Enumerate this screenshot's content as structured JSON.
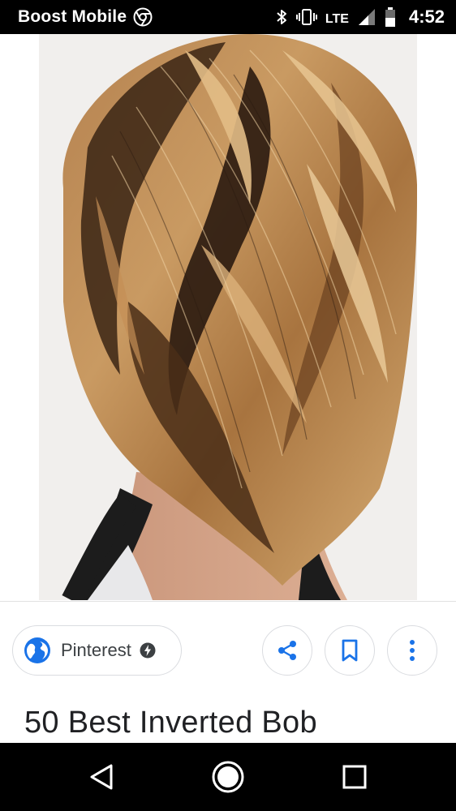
{
  "status_bar": {
    "carrier": "Boost Mobile",
    "network": "LTE",
    "time": "4:52",
    "icons": [
      "chrome-icon",
      "bluetooth-icon",
      "vibrate-icon",
      "signal-icon",
      "battery-icon"
    ]
  },
  "image": {
    "description_icon": "hair-photo",
    "colors": {
      "dark": "#2a1a10",
      "mid": "#8a5a30",
      "light": "#c99a62",
      "highlight": "#e2bd86",
      "skin": "#c9957a"
    }
  },
  "source": {
    "label": "Pinterest",
    "icon": "globe-icon",
    "badge_icon": "amp-bolt-icon"
  },
  "actions": {
    "share_icon": "share-icon",
    "save_icon": "bookmark-icon",
    "more_icon": "more-vert-icon",
    "accent_color": "#1a73e8"
  },
  "result": {
    "title": "50 Best Inverted Bob"
  },
  "nav_bar": {
    "buttons": [
      "back-icon",
      "home-icon",
      "recents-icon"
    ]
  }
}
